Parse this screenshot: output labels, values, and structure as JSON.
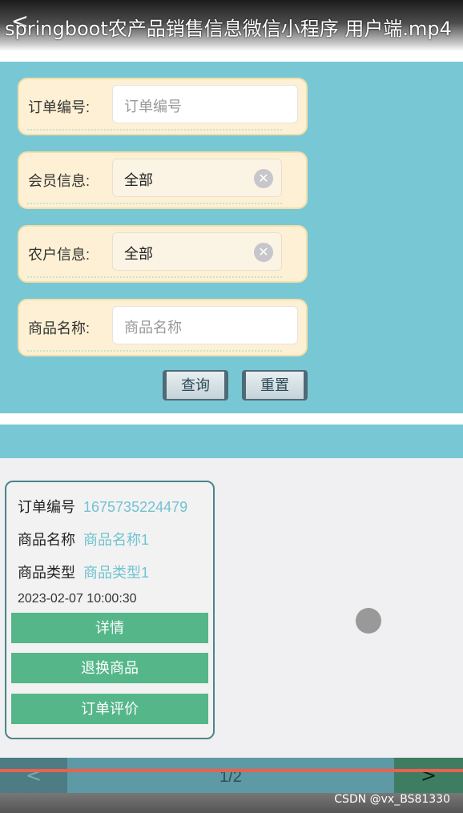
{
  "header": {
    "video_title": "springboot农产品销售信息微信小程序 用户端.mp4",
    "back_glyph": "<"
  },
  "search": {
    "fields": [
      {
        "label": "订单编号:",
        "placeholder": "订单编号"
      },
      {
        "label": "会员信息:",
        "value": "全部"
      },
      {
        "label": "农户信息:",
        "value": "全部"
      },
      {
        "label": "商品名称:",
        "placeholder": "商品名称"
      }
    ],
    "query_label": "查询",
    "reset_label": "重置"
  },
  "order_card": {
    "order_no_label": "订单编号",
    "order_no": "1675735224479",
    "product_name_label": "商品名称",
    "product_name": "商品名称1",
    "product_type_label": "商品类型",
    "product_type": "商品类型1",
    "datetime": "2023-02-07 10:00:30",
    "detail_label": "详情",
    "return_label": "退换商品",
    "review_label": "订单评价"
  },
  "pager": {
    "prev": "<",
    "page": "1/2",
    "next": ">"
  },
  "watermark": "CSDN @vx_BS81330"
}
